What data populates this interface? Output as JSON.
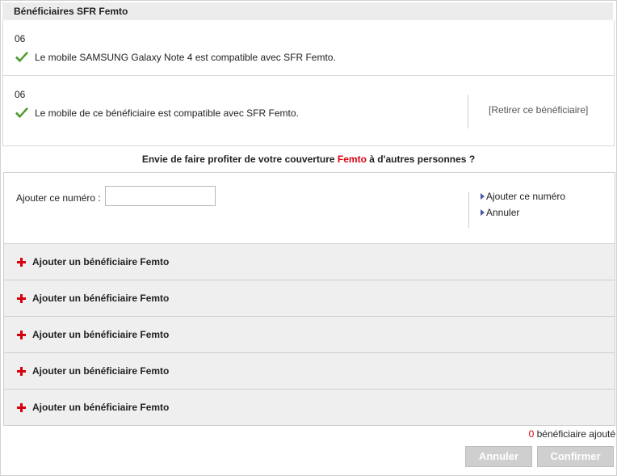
{
  "header": {
    "title": "Bénéficiaires SFR Femto"
  },
  "beneficiaries": [
    {
      "number": "06",
      "status": "Le mobile SAMSUNG Galaxy Note 4 est compatible avec SFR Femto."
    },
    {
      "number": "06",
      "status": "Le mobile de ce bénéficiaire est compatible avec SFR Femto.",
      "remove_label": "[Retirer ce bénéficiaire]"
    }
  ],
  "invite": {
    "before": "Envie de faire profiter de votre couverture ",
    "accent": "Femto",
    "after": " à d'autres personnes ?"
  },
  "add_form": {
    "label": "Ajouter ce numéro :",
    "input_value": "",
    "add_link": "Ajouter ce numéro",
    "cancel_link": "Annuler"
  },
  "add_rows": [
    {
      "label": "Ajouter un bénéficiaire Femto"
    },
    {
      "label": "Ajouter un bénéficiaire Femto"
    },
    {
      "label": "Ajouter un bénéficiaire Femto"
    },
    {
      "label": "Ajouter un bénéficiaire Femto"
    },
    {
      "label": "Ajouter un bénéficiaire Femto"
    }
  ],
  "counter": {
    "value": "0",
    "suffix": " bénéficiaire ajouté"
  },
  "buttons": {
    "cancel": "Annuler",
    "confirm": "Confirmer"
  },
  "colors": {
    "accent": "#d7000f",
    "check": "#4a9a2a",
    "button_disabled": "#cfcfcf"
  }
}
